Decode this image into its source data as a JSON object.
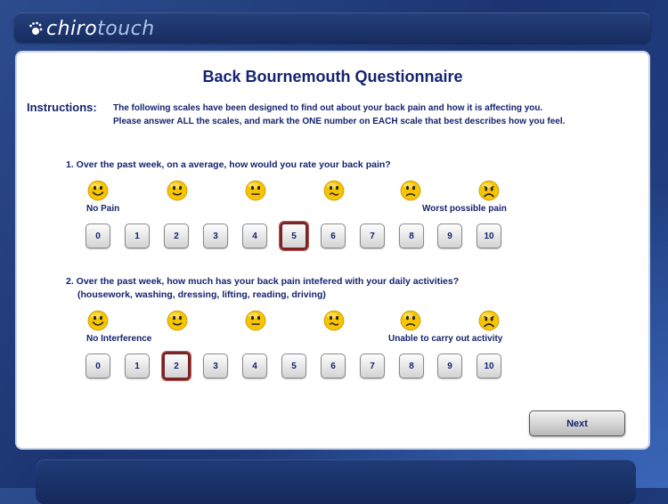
{
  "app": {
    "logo_part1": "chiro",
    "logo_part2": "touch"
  },
  "page": {
    "title": "Back Bournemouth Questionnaire",
    "instructions_label": "Instructions:",
    "instructions_line1": "The following scales have been designed to find out about your back pain and how it is affecting you.",
    "instructions_line2": "Please answer ALL the scales, and mark the ONE number on EACH scale that best describes how you feel."
  },
  "questions": [
    {
      "text_line1": "1. Over the past week, on a average, how would you rate your back pain?",
      "text_line2": "",
      "low_label": "No Pain",
      "high_label": "Worst possible pain",
      "options": [
        "0",
        "1",
        "2",
        "3",
        "4",
        "5",
        "6",
        "7",
        "8",
        "9",
        "10"
      ],
      "selected": "5"
    },
    {
      "text_line1": "2. Over the past week, how much has your back pain intefered with your daily activities?",
      "text_line2": "(housework, washing, dressing, lifting, reading, driving)",
      "low_label": "No Interference",
      "high_label": "Unable to carry out activity",
      "options": [
        "0",
        "1",
        "2",
        "3",
        "4",
        "5",
        "6",
        "7",
        "8",
        "9",
        "10"
      ],
      "selected": "2"
    }
  ],
  "faces": [
    "very-happy-face-icon",
    "happy-face-icon",
    "neutral-face-icon",
    "wavy-mouth-face-icon",
    "sad-face-icon",
    "very-sad-face-icon"
  ],
  "actions": {
    "next_label": "Next"
  },
  "colors": {
    "text_navy": "#16236e",
    "selected_border": "#7b2424",
    "background_blue": "#1c3572"
  }
}
